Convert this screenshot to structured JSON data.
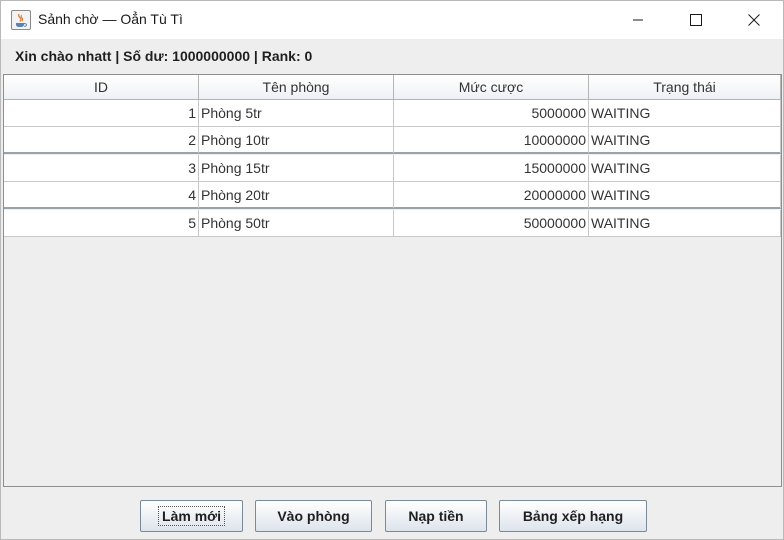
{
  "window": {
    "title": "Sảnh chờ — Oẳn Tù Tì",
    "controls": [
      "minimize",
      "maximize",
      "close"
    ]
  },
  "info": {
    "text": "Xin chào nhatt | Số dư: 1000000000 | Rank: 0"
  },
  "table": {
    "columns": [
      "ID",
      "Tên phòng",
      "Mức cược",
      "Trạng thái"
    ],
    "rows": [
      {
        "id": "1",
        "name": "Phòng 5tr",
        "bet": "5000000",
        "status": "WAITING"
      },
      {
        "id": "2",
        "name": "Phòng 10tr",
        "bet": "10000000",
        "status": "WAITING"
      },
      {
        "id": "3",
        "name": "Phòng 15tr",
        "bet": "15000000",
        "status": "WAITING"
      },
      {
        "id": "4",
        "name": "Phòng 20tr",
        "bet": "20000000",
        "status": "WAITING"
      },
      {
        "id": "5",
        "name": "Phòng 50tr",
        "bet": "50000000",
        "status": "WAITING"
      }
    ]
  },
  "buttons": {
    "refresh": "Làm mới",
    "join": "Vào phòng",
    "topup": "Nạp tiền",
    "leaderboard": "Bảng xếp hạng"
  }
}
